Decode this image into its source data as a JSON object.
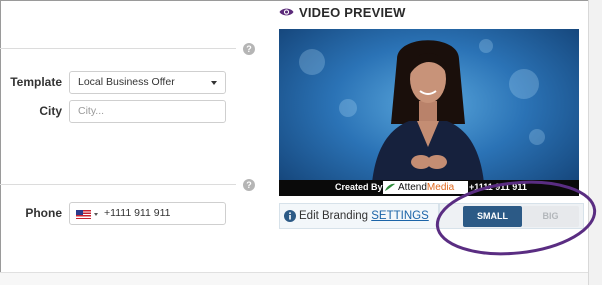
{
  "form": {
    "template_label": "Template",
    "template_value": "Local Business Offer",
    "city_label": "City",
    "city_placeholder": "City...",
    "phone_label": "Phone",
    "phone_value": "+1111 911 911",
    "help_symbol": "?"
  },
  "video_preview": {
    "title": "VIDEO PREVIEW",
    "caption": {
      "created_by": "Created By:",
      "logo_text_1": "Attend",
      "logo_text_2": "Media",
      "phone": "+1111 911 911"
    }
  },
  "branding": {
    "label": "Edit Branding",
    "link": "SETTINGS"
  },
  "size_toggle": {
    "small_label": "SMALL",
    "big_label": "BIG",
    "selected": "SMALL"
  },
  "colors": {
    "accent": "#2c5a86",
    "link": "#1b64a8",
    "highlight_oval": "#5a2d82"
  }
}
